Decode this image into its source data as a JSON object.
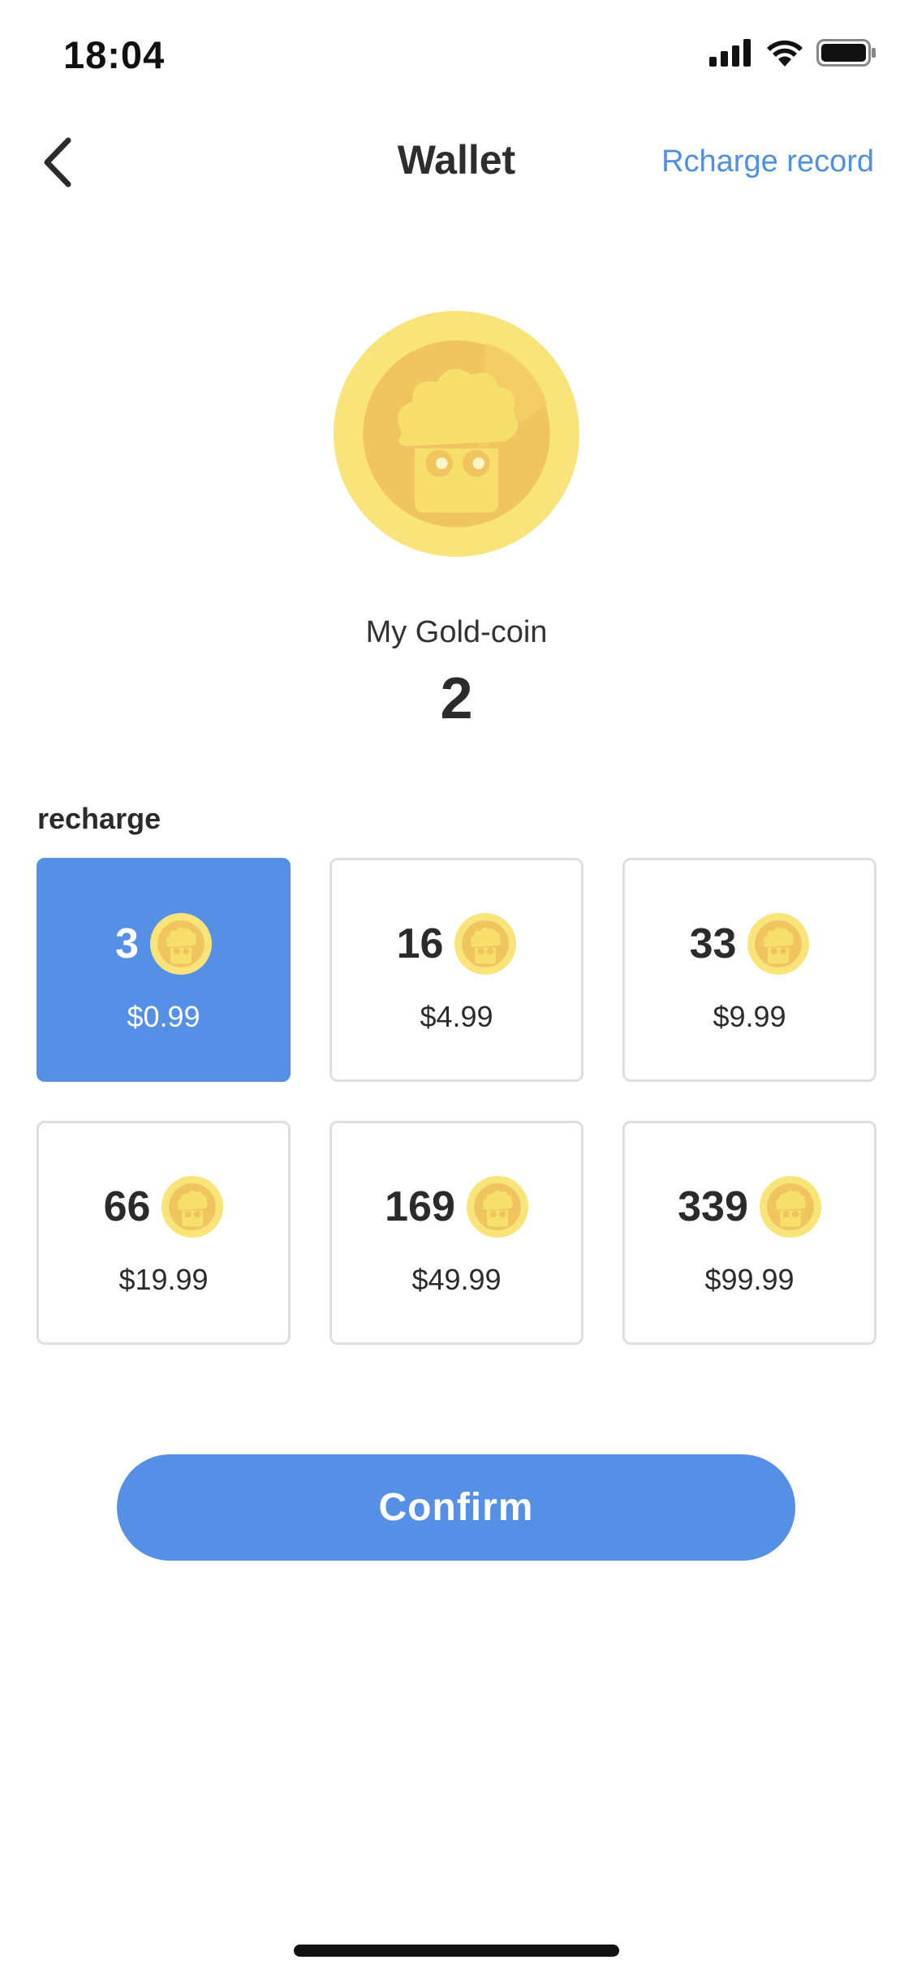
{
  "status_bar": {
    "time": "18:04"
  },
  "nav": {
    "title": "Wallet",
    "record_link": "Rcharge record",
    "back_icon": "chevron-left-icon"
  },
  "balance": {
    "label": "My Gold-coin",
    "value": "2",
    "icon": "gold-coin-icon"
  },
  "recharge": {
    "title": "recharge",
    "packages": [
      {
        "amount": "3",
        "price": "$0.99",
        "selected": true
      },
      {
        "amount": "16",
        "price": "$4.99",
        "selected": false
      },
      {
        "amount": "33",
        "price": "$9.99",
        "selected": false
      },
      {
        "amount": "66",
        "price": "$19.99",
        "selected": false
      },
      {
        "amount": "169",
        "price": "$49.99",
        "selected": false
      },
      {
        "amount": "339",
        "price": "$99.99",
        "selected": false
      }
    ]
  },
  "confirm_label": "Confirm",
  "colors": {
    "accent": "#5590e6",
    "link": "#4f8fe6",
    "coin_light": "#f9e47a",
    "coin_dark": "#f0c45e"
  }
}
